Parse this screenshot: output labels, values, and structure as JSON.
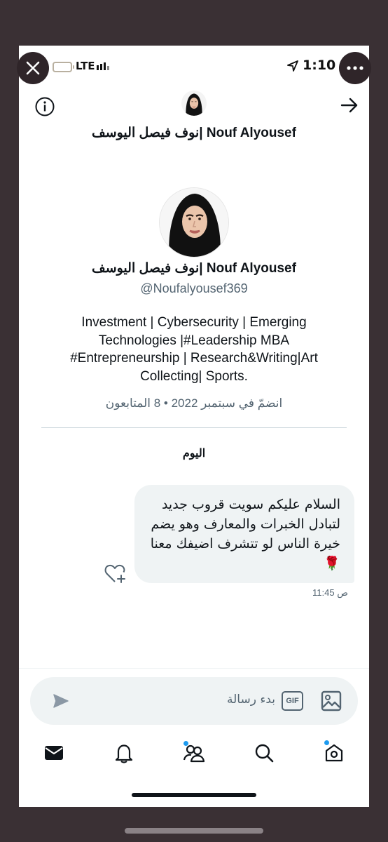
{
  "status_bar": {
    "network": "LTE",
    "time": "1:10"
  },
  "header": {
    "title": "نوف فيصل اليوسف| Nouf Alyousef"
  },
  "profile": {
    "name": "نوف فيصل اليوسف| Nouf Alyousef",
    "handle": "@Noufalyousef369",
    "bio": "Investment | Cybersecurity | Emerging Technologies |#Leadership MBA #Entrepreneurship | Research&Writing|Art Collecting| Sports.",
    "meta": "انضمّ في سبتمبر 2022 • 8 المتابعون"
  },
  "conversation": {
    "day_label": "اليوم",
    "messages": [
      {
        "text": "السلام عليكم سويت قروب جديد لتبادل الخبرات والمعارف وهو يضم خيرة الناس لو تتشرف اضيفك معنا 🌹",
        "time": "11:45 ص"
      }
    ]
  },
  "composer": {
    "placeholder": "بدء رسالة",
    "gif_label": "GIF"
  },
  "nav": {
    "items": [
      "messages-icon",
      "notifications-icon",
      "communities-icon",
      "search-icon",
      "home-icon"
    ]
  },
  "colors": {
    "accent": "#1d9bf0",
    "text": "#0f1419",
    "muted": "#536471",
    "bubble": "#eff3f4"
  }
}
